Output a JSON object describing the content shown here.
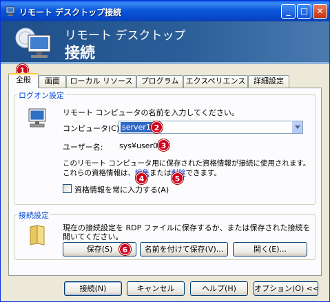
{
  "window": {
    "title": "リモート デスクトップ接続",
    "minimize_label": "_",
    "maximize_label": "□",
    "close_label": "✕"
  },
  "banner": {
    "subtitle": "リモート デスクトップ",
    "title": "接続"
  },
  "tabs": [
    {
      "label": "全般",
      "active": true
    },
    {
      "label": "画面",
      "active": false
    },
    {
      "label": "ローカル リソース",
      "active": false
    },
    {
      "label": "プログラム",
      "active": false
    },
    {
      "label": "エクスペリエンス",
      "active": false
    },
    {
      "label": "詳細設定",
      "active": false
    }
  ],
  "logon": {
    "group_label": "ログオン設定",
    "instruction": "リモート コンピュータの名前を入力してください。",
    "computer_label": "コンピュータ(C):",
    "computer_value": "server1",
    "username_label": "ユーザー名:",
    "username_value": "sys¥user01",
    "info_line1": "このリモート コンピュータ用に保存された資格情報が接続に使用されます。",
    "info_line2_prefix": "これらの資格情報は、",
    "edit_link": "編集",
    "info_line2_mid": "または",
    "delete_link": "削除",
    "info_line2_suffix": "できます。",
    "always_prompt_label": "資格情報を常に入力する(A)",
    "always_prompt_checked": false
  },
  "connection": {
    "group_label": "接続設定",
    "description_line1": "現在の接続設定を RDP ファイルに保存するか、または保存された接続を",
    "description_line2": "開いてください。",
    "save_label": "保存(S)",
    "save_as_label": "名前を付けて保存(V)...",
    "open_label": "開く(E)..."
  },
  "footer": {
    "connect_label": "接続(N)",
    "cancel_label": "キャンセル",
    "help_label": "ヘルプ(H)",
    "options_label": "オプション(O) <<"
  },
  "badges": [
    "1",
    "2",
    "3",
    "4",
    "5",
    "6"
  ],
  "colors": {
    "badge": "#d3001d",
    "group_label": "#0046d5",
    "selection": "#316ac5"
  }
}
